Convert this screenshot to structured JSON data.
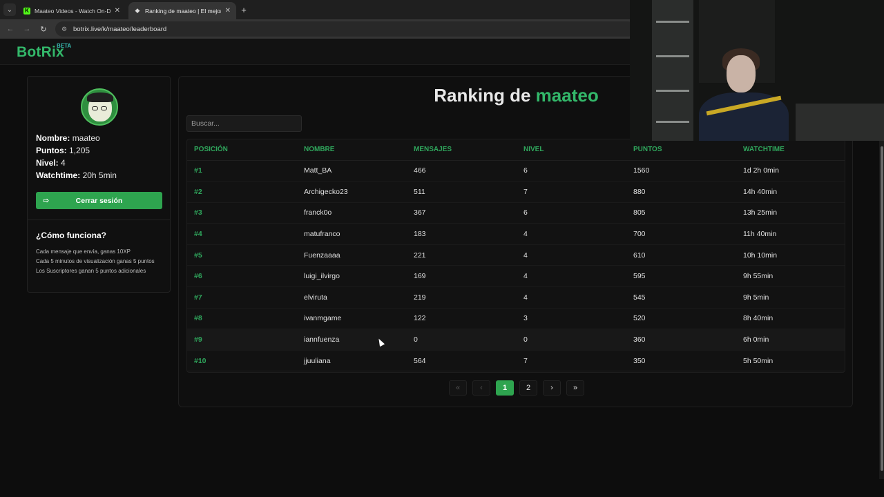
{
  "browser": {
    "tabs": [
      {
        "title": "Maateo Videos - Watch On-Demand",
        "favicon": "kick-icon"
      },
      {
        "title": "Ranking de maateo | El mejor s",
        "favicon": "botrix-icon"
      }
    ],
    "url": "botrix.live/k/maateo/leaderboard"
  },
  "header": {
    "logo": "BotRix",
    "badge": "BETA",
    "accent_color": "#33b86a"
  },
  "profile": {
    "name_label": "Nombre:",
    "name": "maateo",
    "points_label": "Puntos:",
    "points": "1,205",
    "level_label": "Nivel:",
    "level": "4",
    "watchtime_label": "Watchtime:",
    "watchtime": "20h 5min",
    "logout_label": "Cerrar sesión"
  },
  "how": {
    "title": "¿Cómo funciona?",
    "items": [
      "Cada mensaje que envía, ganas 10XP",
      "Cada 5 minutos de visualización ganas 5 puntos",
      "Los Suscriptores ganan 5 puntos adicionales"
    ]
  },
  "ranking": {
    "title_prefix": "Ranking de",
    "title_user": "maateo",
    "search_placeholder": "Buscar...",
    "columns": [
      "POSICIÓN",
      "NOMBRE",
      "MENSAJES",
      "NIVEL",
      "PUNTOS",
      "WATCHTIME"
    ],
    "rows": [
      {
        "pos": "#1",
        "name": "Matt_BA",
        "messages": "466",
        "level": "6",
        "points": "1560",
        "watchtime": "1d 2h 0min"
      },
      {
        "pos": "#2",
        "name": "Archigecko23",
        "messages": "511",
        "level": "7",
        "points": "880",
        "watchtime": "14h 40min"
      },
      {
        "pos": "#3",
        "name": "franck0o",
        "messages": "367",
        "level": "6",
        "points": "805",
        "watchtime": "13h 25min"
      },
      {
        "pos": "#4",
        "name": "matufranco",
        "messages": "183",
        "level": "4",
        "points": "700",
        "watchtime": "11h 40min"
      },
      {
        "pos": "#5",
        "name": "Fuenzaaaa",
        "messages": "221",
        "level": "4",
        "points": "610",
        "watchtime": "10h 10min"
      },
      {
        "pos": "#6",
        "name": "luigi_ilvirgo",
        "messages": "169",
        "level": "4",
        "points": "595",
        "watchtime": "9h 55min"
      },
      {
        "pos": "#7",
        "name": "elviruta",
        "messages": "219",
        "level": "4",
        "points": "545",
        "watchtime": "9h 5min"
      },
      {
        "pos": "#8",
        "name": "ivanmgame",
        "messages": "122",
        "level": "3",
        "points": "520",
        "watchtime": "8h 40min"
      },
      {
        "pos": "#9",
        "name": "iannfuenza",
        "messages": "0",
        "level": "0",
        "points": "360",
        "watchtime": "6h 0min"
      },
      {
        "pos": "#10",
        "name": "jjuuliana",
        "messages": "564",
        "level": "7",
        "points": "350",
        "watchtime": "5h 50min"
      }
    ],
    "pagination": {
      "first": "«",
      "prev": "‹",
      "pages": [
        "1",
        "2"
      ],
      "current": "1",
      "next": "›",
      "last": "»"
    }
  }
}
